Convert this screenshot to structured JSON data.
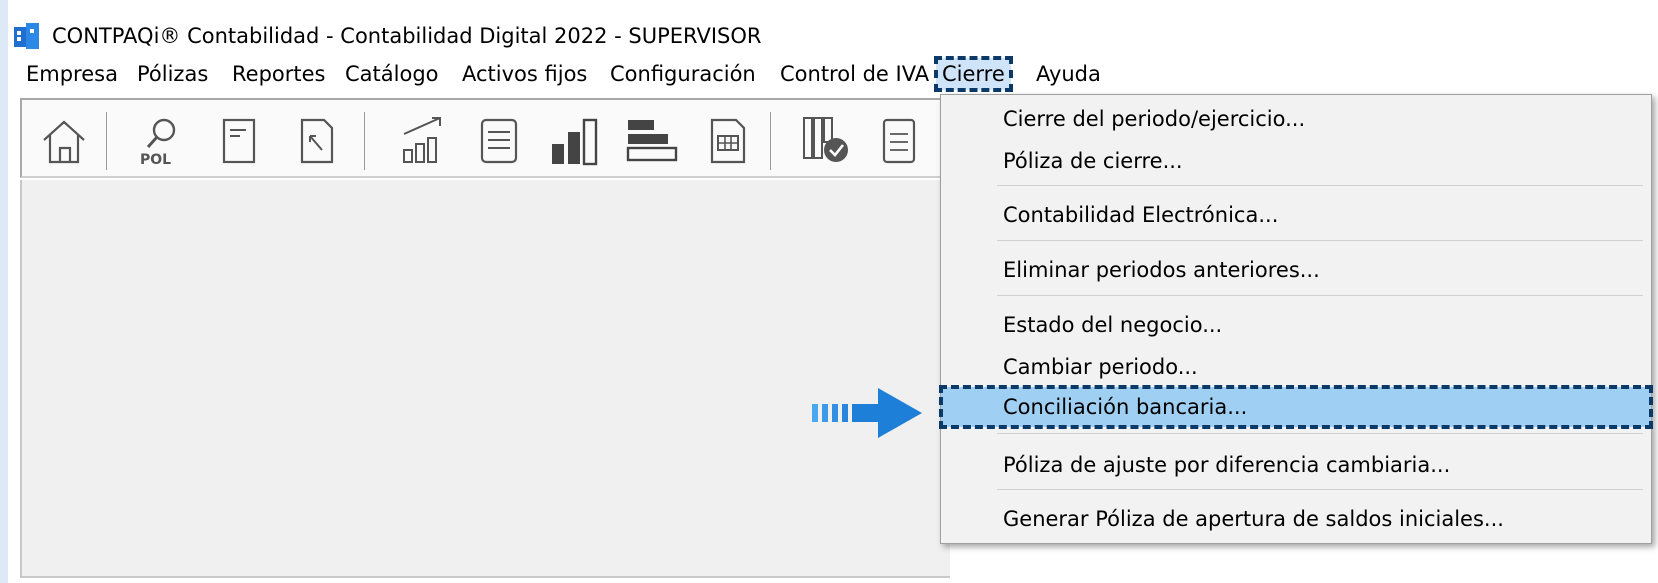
{
  "window": {
    "title": "CONTPAQi® Contabilidad - Contabilidad Digital 2022 - SUPERVISOR"
  },
  "menubar": {
    "items": [
      {
        "label": "Empresa"
      },
      {
        "label": "Pólizas"
      },
      {
        "label": "Reportes"
      },
      {
        "label": "Catálogo"
      },
      {
        "label": "Activos fijos"
      },
      {
        "label": "Configuración"
      },
      {
        "label": "Control de IVA"
      },
      {
        "label": "Cierre"
      },
      {
        "label": "Ayuda"
      }
    ],
    "active": "Cierre"
  },
  "toolbar": {
    "pol_label": "POL",
    "icons": [
      "home-icon",
      "search-polizas-icon",
      "document-icon",
      "document-edit-icon",
      "chart-trend-icon",
      "list-document-icon",
      "bar-chart-icon",
      "horizontal-bars-icon",
      "table-icon",
      "columns-check-icon",
      "list-icon"
    ]
  },
  "cierre_menu": {
    "items": [
      {
        "label": "Cierre del periodo/ejercicio..."
      },
      {
        "label": "Póliza de cierre..."
      },
      {
        "label": "Contabilidad Electrónica..."
      },
      {
        "label": "Eliminar periodos anteriores..."
      },
      {
        "label": "Estado del negocio..."
      },
      {
        "label": "Cambiar periodo..."
      },
      {
        "label": "Conciliación bancaria..."
      },
      {
        "label": "Póliza de ajuste por diferencia cambiaria..."
      },
      {
        "label": "Generar Póliza de apertura de saldos iniciales..."
      }
    ],
    "highlighted": "Conciliación bancaria..."
  },
  "colors": {
    "highlight": "#9fd0f3",
    "outline": "#0b3a68",
    "arrow": "#1e7fd8"
  }
}
